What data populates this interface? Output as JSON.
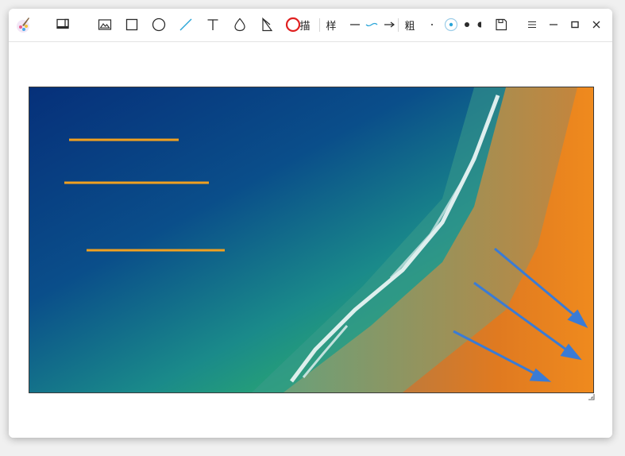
{
  "app": {
    "icon": "paint-brush-app-icon"
  },
  "toolbar": {
    "tools": [
      {
        "name": "screenshot-window-tool",
        "icon": "window-capture-icon"
      },
      {
        "name": "image-tool",
        "icon": "image-icon"
      },
      {
        "name": "rectangle-tool",
        "icon": "rectangle-icon"
      },
      {
        "name": "ellipse-tool",
        "icon": "circle-icon"
      },
      {
        "name": "line-tool",
        "icon": "line-icon"
      },
      {
        "name": "text-tool",
        "icon": "text-icon"
      },
      {
        "name": "blur-tool",
        "icon": "drop-icon"
      },
      {
        "name": "polygon-tool",
        "icon": "polygon-icon"
      }
    ],
    "stroke_label": "描",
    "stroke_color": "#e02020",
    "style_label": "样",
    "thickness_label": "粗",
    "accent_color": "#2aa5d8",
    "arrow_color": "#3a7bd5",
    "line_color": "#f0a020"
  },
  "window_controls": {
    "menu": "menu-icon",
    "minimize": "minimize-icon",
    "maximize": "maximize-icon",
    "close": "close-icon"
  }
}
